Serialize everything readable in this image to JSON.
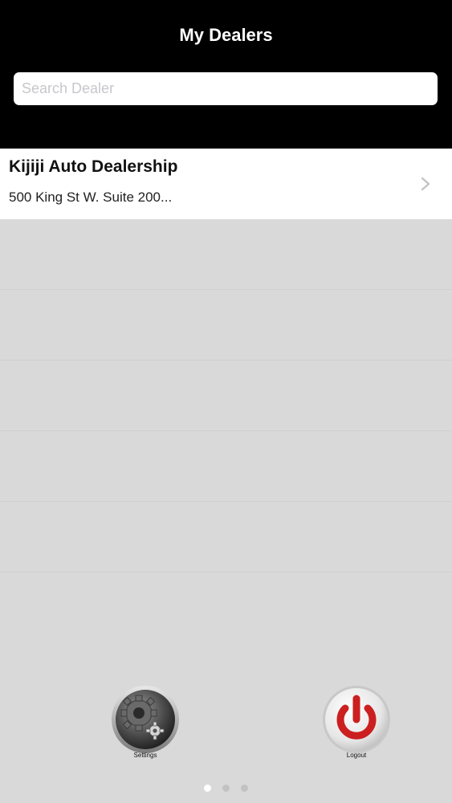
{
  "header": {
    "title": "My Dealers"
  },
  "search": {
    "placeholder": "Search Dealer",
    "value": ""
  },
  "dealers": [
    {
      "name": "Kijiji Auto Dealership",
      "address": "500 King St W. Suite 200..."
    }
  ],
  "dock": {
    "settings_label": "Settings",
    "logout_label": "Logout"
  },
  "pagination": {
    "total": 3,
    "current": 1
  },
  "colors": {
    "header_bg": "#000000",
    "list_bg": "#d9d9da",
    "logout_red": "#cc1f1f"
  }
}
